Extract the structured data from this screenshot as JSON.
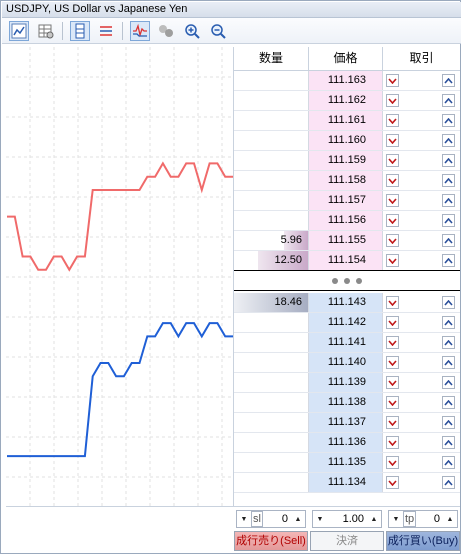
{
  "window": {
    "title": "USDJPY, US Dollar vs Japanese Yen"
  },
  "toolbar": {
    "buttons": [
      {
        "icon": "chart-mode-icon",
        "active": true
      },
      {
        "icon": "table-mode-icon",
        "active": false
      },
      {
        "icon": "depth-icon",
        "active": true
      },
      {
        "icon": "trade-list-icon",
        "active": false
      },
      {
        "icon": "ticks-chart-icon",
        "active": true
      },
      {
        "icon": "bubbles-icon",
        "active": false
      },
      {
        "icon": "zoom-in-icon",
        "active": false
      },
      {
        "icon": "zoom-out-icon",
        "active": false
      }
    ]
  },
  "depth": {
    "headers": {
      "volume": "数量",
      "price": "価格",
      "trade": "取引"
    },
    "asks": [
      {
        "price": "111.163",
        "volume": ""
      },
      {
        "price": "111.162",
        "volume": ""
      },
      {
        "price": "111.161",
        "volume": ""
      },
      {
        "price": "111.160",
        "volume": ""
      },
      {
        "price": "111.159",
        "volume": ""
      },
      {
        "price": "111.158",
        "volume": ""
      },
      {
        "price": "111.157",
        "volume": ""
      },
      {
        "price": "111.156",
        "volume": ""
      },
      {
        "price": "111.155",
        "volume": "5.96",
        "fill": 0.32
      },
      {
        "price": "111.154",
        "volume": "12.50",
        "fill": 0.67
      }
    ],
    "bids": [
      {
        "price": "111.143",
        "volume": "18.46",
        "fill": 1.0
      },
      {
        "price": "111.142",
        "volume": ""
      },
      {
        "price": "111.141",
        "volume": ""
      },
      {
        "price": "111.140",
        "volume": ""
      },
      {
        "price": "111.139",
        "volume": ""
      },
      {
        "price": "111.138",
        "volume": ""
      },
      {
        "price": "111.137",
        "volume": ""
      },
      {
        "price": "111.136",
        "volume": ""
      },
      {
        "price": "111.135",
        "volume": ""
      },
      {
        "price": "111.134",
        "volume": ""
      }
    ]
  },
  "controls": {
    "sl": {
      "label": "sl",
      "value": "0"
    },
    "volume": {
      "value": "1.00"
    },
    "tp": {
      "label": "tp",
      "value": "0"
    },
    "sell_label": "成行売り(Sell)",
    "close_label": "決済",
    "buy_label": "成行買い(Buy)"
  },
  "colors": {
    "ask_line": "#f06a6a",
    "bid_line": "#1f5fd6",
    "ask_bg": "#fbe3f5",
    "bid_bg": "#d6e4f7"
  },
  "tick_chart": {
    "ask": [
      111.151,
      111.151,
      111.148,
      111.148,
      111.147,
      111.147,
      111.148,
      111.148,
      111.147,
      111.148,
      111.148,
      111.153,
      111.153,
      111.153,
      111.153,
      111.153,
      111.153,
      111.153,
      111.154,
      111.154,
      111.155,
      111.154,
      111.154,
      111.155,
      111.155,
      111.153,
      111.155,
      111.155,
      111.154,
      111.154
    ],
    "bid": [
      111.133,
      111.133,
      111.133,
      111.133,
      111.133,
      111.133,
      111.133,
      111.133,
      111.133,
      111.133,
      111.133,
      111.139,
      111.14,
      111.14,
      111.139,
      111.139,
      111.14,
      111.14,
      111.142,
      111.142,
      111.143,
      111.143,
      111.142,
      111.143,
      111.143,
      111.142,
      111.143,
      111.143,
      111.142,
      111.142
    ],
    "y_range": [
      111.13,
      111.163
    ]
  }
}
